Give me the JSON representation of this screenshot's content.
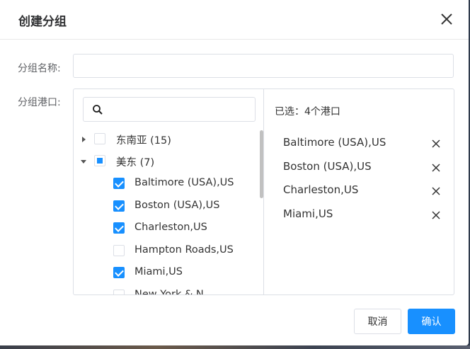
{
  "dialog": {
    "title": "创建分组",
    "close_icon": "close-icon"
  },
  "form": {
    "name_label": "分组名称:",
    "name_value": "",
    "name_placeholder": "",
    "ports_label": "分组港口:"
  },
  "transfer": {
    "search_value": "",
    "search_placeholder": "",
    "tree": [
      {
        "label": "东南亚 (15)",
        "level": 0,
        "expanded": false,
        "state": "unchecked"
      },
      {
        "label": "美东 (7)",
        "level": 0,
        "expanded": true,
        "state": "partial"
      },
      {
        "label": "Baltimore (USA),US",
        "level": 1,
        "state": "checked"
      },
      {
        "label": "Boston (USA),US",
        "level": 1,
        "state": "checked"
      },
      {
        "label": "Charleston,US",
        "level": 1,
        "state": "checked"
      },
      {
        "label": "Hampton Roads,US",
        "level": 1,
        "state": "unchecked"
      },
      {
        "label": "Miami,US",
        "level": 1,
        "state": "checked"
      },
      {
        "label": "New York & N...",
        "level": 1,
        "state": "unchecked"
      }
    ],
    "selected_title": "已选：4个港口",
    "selected": [
      {
        "label": "Baltimore (USA),US",
        "remove": "X"
      },
      {
        "label": "Boston (USA),US",
        "remove": "X"
      },
      {
        "label": "Charleston,US",
        "remove": "X"
      },
      {
        "label": "Miami,US",
        "remove": "X"
      }
    ]
  },
  "buttons": {
    "cancel": "取消",
    "confirm": "确认"
  },
  "colors": {
    "primary": "#1890ff",
    "border": "#dcdfe6",
    "text": "#333333"
  }
}
